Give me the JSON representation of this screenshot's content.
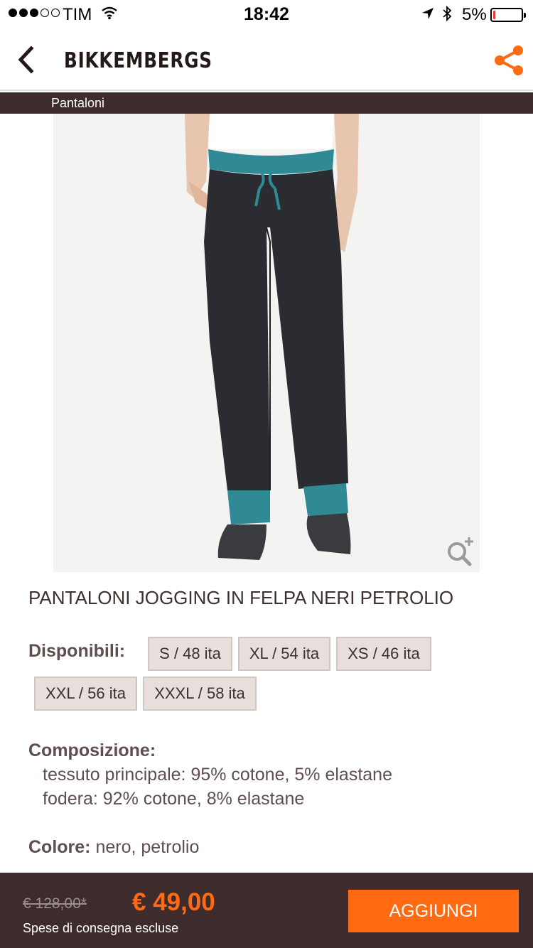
{
  "status_bar": {
    "carrier": "TIM",
    "time": "18:42",
    "battery_percent": "5%",
    "battery_level": 0.05,
    "signal_bars_filled": 3,
    "signal_bars_total": 5,
    "icons": [
      "signal-dots-icon",
      "wifi-icon",
      "location-arrow-icon",
      "bluetooth-icon",
      "battery-icon"
    ]
  },
  "header": {
    "brand": "BIKKEMBERGS",
    "back_icon": "chevron-left-icon",
    "share_icon": "share-icon",
    "accent_color": "#ff6a13"
  },
  "breadcrumb": {
    "category": "Pantaloni"
  },
  "product": {
    "image": "black jogging pants with petrol-blue waistband and cuffs",
    "zoom_icon": "zoom-in-icon",
    "title": "PANTALONI JOGGING IN FELPA NERI PETROLIO",
    "availability_label": "Disponibili:",
    "sizes": [
      "S / 48 ita",
      "XL / 54 ita",
      "XS / 46 ita",
      "XXL / 56 ita",
      "XXXL / 58 ita"
    ],
    "composition_label": "Composizione:",
    "composition_lines": [
      "tessuto principale: 95% cotone, 5% elastane",
      "fodera: 92% cotone, 8% elastane"
    ],
    "color_label": "Colore:",
    "color_value": " nero, petrolio"
  },
  "purchase_bar": {
    "old_price": "€ 128,00*",
    "new_price": "€ 49,00",
    "shipping_note": "Spese di consegna escluse",
    "add_button": "AGGIUNGI",
    "bar_color": "#3d2c2b"
  }
}
